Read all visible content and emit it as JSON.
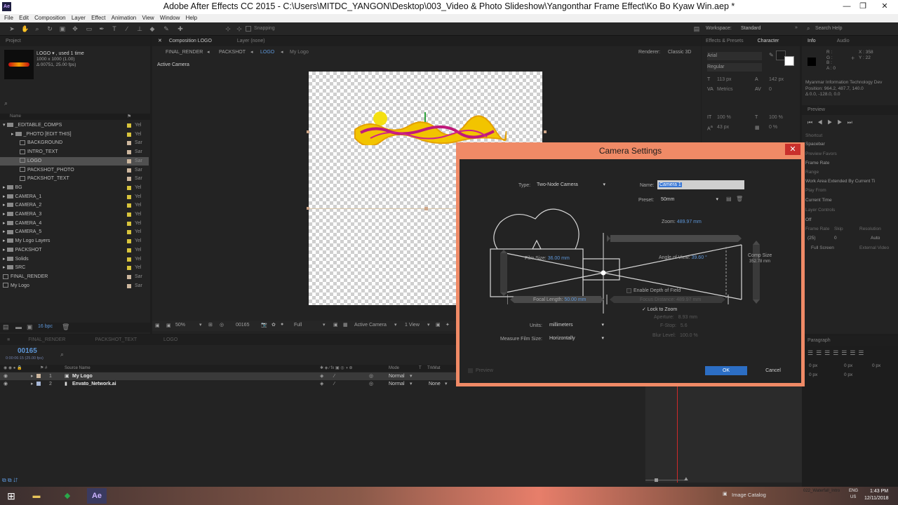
{
  "window": {
    "title": "Adobe After Effects CC 2015 - C:\\Users\\MITDC_YANGON\\Desktop\\003_Video & Photo Slideshow\\Yangonthar Frame Effect\\Ko Bo Kyaw Win.aep *",
    "minimize": "—",
    "maximize": "❐",
    "close": "✕"
  },
  "menu": [
    "File",
    "Edit",
    "Composition",
    "Layer",
    "Effect",
    "Animation",
    "View",
    "Window",
    "Help"
  ],
  "toolbar": {
    "snapping": "Snapping",
    "workspace_label": "Workspace:",
    "workspace_value": "Standard",
    "search_placeholder": "Search Help"
  },
  "project": {
    "tab": "Project",
    "item_name": "LOGO ▾ , used 1 time",
    "item_size": "1000 x 1000 (1.00)",
    "item_duration": "Δ 00751, 25.00 fps)",
    "search_icon": "magnifier-icon",
    "col_name": "Name",
    "bpc": "16 bpc",
    "items": [
      {
        "name": "_EDITABLE_COMPS",
        "indent": 0,
        "kind": "folder",
        "open": true,
        "color": "#d8c43c",
        "type": "Yel"
      },
      {
        "name": "_PHOTO [EDIT THIS]",
        "indent": 1,
        "kind": "folder",
        "open": false,
        "color": "#d8c43c",
        "type": "Yel"
      },
      {
        "name": "BACKGROUND",
        "indent": 2,
        "kind": "comp",
        "color": "#cdb79e",
        "type": "Sar"
      },
      {
        "name": "INTRO_TEXT",
        "indent": 2,
        "kind": "comp",
        "color": "#cdb79e",
        "type": "Sar"
      },
      {
        "name": "LOGO",
        "indent": 2,
        "kind": "comp",
        "color": "#cdb79e",
        "type": "Sar",
        "selected": true
      },
      {
        "name": "PACKSHOT_PHOTO",
        "indent": 2,
        "kind": "comp",
        "color": "#cdb79e",
        "type": "Sar"
      },
      {
        "name": "PACKSHOT_TEXT",
        "indent": 2,
        "kind": "comp",
        "color": "#cdb79e",
        "type": "Sar"
      },
      {
        "name": "BG",
        "indent": 0,
        "kind": "folder",
        "open": false,
        "color": "#d8c43c",
        "type": "Yel"
      },
      {
        "name": "CAMERA_1",
        "indent": 0,
        "kind": "folder",
        "open": false,
        "color": "#d8c43c",
        "type": "Yel"
      },
      {
        "name": "CAMERA_2",
        "indent": 0,
        "kind": "folder",
        "open": false,
        "color": "#d8c43c",
        "type": "Yel"
      },
      {
        "name": "CAMERA_3",
        "indent": 0,
        "kind": "folder",
        "open": false,
        "color": "#d8c43c",
        "type": "Yel"
      },
      {
        "name": "CAMERA_4",
        "indent": 0,
        "kind": "folder",
        "open": false,
        "color": "#d8c43c",
        "type": "Yel"
      },
      {
        "name": "CAMERA_5",
        "indent": 0,
        "kind": "folder",
        "open": false,
        "color": "#d8c43c",
        "type": "Yel"
      },
      {
        "name": "My Logo Layers",
        "indent": 0,
        "kind": "folder",
        "open": false,
        "color": "#d8c43c",
        "type": "Yel"
      },
      {
        "name": "PACKSHOT",
        "indent": 0,
        "kind": "folder",
        "open": false,
        "color": "#d8c43c",
        "type": "Yel"
      },
      {
        "name": "Solids",
        "indent": 0,
        "kind": "folder",
        "open": false,
        "color": "#d8c43c",
        "type": "Yel"
      },
      {
        "name": "SRC",
        "indent": 0,
        "kind": "folder",
        "open": false,
        "color": "#d8c43c",
        "type": "Yel"
      },
      {
        "name": "FINAL_RENDER",
        "indent": 0,
        "kind": "comp",
        "color": "#cdb79e",
        "type": "Sar"
      },
      {
        "name": "My Logo",
        "indent": 0,
        "kind": "comp",
        "color": "#cdb79e",
        "type": "Sar"
      }
    ]
  },
  "composition": {
    "tab": "Composition LOGO",
    "tab2": "Layer (none)",
    "breadcrumbs": [
      "FINAL_RENDER",
      "PACKSHOT",
      "LOGO",
      "My Logo"
    ],
    "renderer": "Renderer:",
    "renderer_value": "Classic 3D",
    "view_label": "Active Camera",
    "zoom": "50%",
    "frame": "00165",
    "resolution": "Full",
    "camera": "Active Camera",
    "views": "1 View"
  },
  "character": {
    "tab": "Character",
    "font": "Arial",
    "style": "Regular",
    "size": "113 px",
    "leading": "142 px",
    "kerning": "Metrics",
    "tracking": "0",
    "vscale": "100 %",
    "hscale": "100 %",
    "baseline": "43 px",
    "tsume": "0 %"
  },
  "info": {
    "tab": "Info",
    "tab2": "Audio",
    "r": "R :",
    "g": "G :",
    "b": "B :",
    "a": "A : 0",
    "x": "X : 358",
    "y": "Y : 22",
    "note1": "Myanmar Information Technology Dev",
    "note2": "Position: 964.2, 487.7, 140.0",
    "note3": "Δ 0.0, -128.0, 0.0"
  },
  "preview": {
    "tab": "Preview",
    "shortcut": "Shortcut",
    "shortcut_value": "Spacebar",
    "fps": "Frame Rate",
    "fps_value": "(25)",
    "range": "Range",
    "range_value": "Work Area Extended By Current Ti",
    "play_from": "Play From",
    "play_from_value": "Current Time",
    "layer_controls": "Layer Controls",
    "layer_controls_value": "Off",
    "skip": "Skip",
    "skip_value": "0",
    "resolution": "Resolution",
    "resolution_value": "Auto",
    "full_screen": "Full Screen",
    "external": "External Video",
    "presets": "Presets",
    "use": "Use Item Playback Frame",
    "frame_rate_label": "Frame Rate",
    "play_favorites": "Preview Favors"
  },
  "paragraph": {
    "tab": "Paragraph",
    "v1": "0 px",
    "v2": "0 px",
    "v3": "0 px",
    "v4": "0 px",
    "v5": "0 px"
  },
  "timeline": {
    "tabs": [
      "FINAL_RENDER",
      "PACKSHOT_TEXT",
      "LOGO"
    ],
    "timecode": "00165",
    "timecode_sub": "0:00:06:15 (25.00 fps)",
    "col_source": "Source Name",
    "col_mode": "Mode",
    "col_t": "T",
    "col_trkmat": "TrkMat",
    "layers": [
      {
        "num": "1",
        "name": "My Logo",
        "mode": "Normal",
        "trkmat": "",
        "selected": true
      },
      {
        "num": "2",
        "name": "Envato_Network.ai",
        "mode": "Normal",
        "trkmat": "None",
        "selected": false
      }
    ]
  },
  "dialog": {
    "title": "Camera Settings",
    "close": "✕",
    "type_label": "Type:",
    "type_value": "Two-Node Camera",
    "name_label": "Name:",
    "name_value": "Camera 1",
    "preset_label": "Preset:",
    "preset_value": "50mm",
    "zoom_label": "Zoom:",
    "zoom_value": "489.97 mm",
    "film_label": "Film Size:",
    "film_value": "36.00 mm",
    "angle_label": "Angle of View:",
    "angle_value": "39.60 °",
    "comp_label": "Comp Size",
    "comp_value": "352.78 mm",
    "dof": "Enable Depth of Field",
    "focal_label": "Focal Length:",
    "focal_value": "50.00 mm",
    "focus_label": "Focus Distance:",
    "focus_value": "489.97 mm",
    "lock_zoom": "Lock to Zoom",
    "aperture_label": "Aperture:",
    "aperture_value": "8.93 mm",
    "fstop_label": "F-Stop:",
    "fstop_value": "5.6",
    "blur_label": "Blur Level:",
    "blur_value": "100.0 %",
    "units_label": "Units:",
    "units_value": "millimeters",
    "measure_label": "Measure Film Size:",
    "measure_value": "Horizontally",
    "preview": "Preview",
    "ok": "OK",
    "cancel": "Cancel"
  },
  "taskbar": {
    "ae": "Ae",
    "image_catalog": "Image Catalog",
    "lang": "ENG",
    "lang2": "US",
    "time": "1:43 PM",
    "date": "12/11/2018",
    "tray_note": "022_Waterfall_Intro"
  }
}
